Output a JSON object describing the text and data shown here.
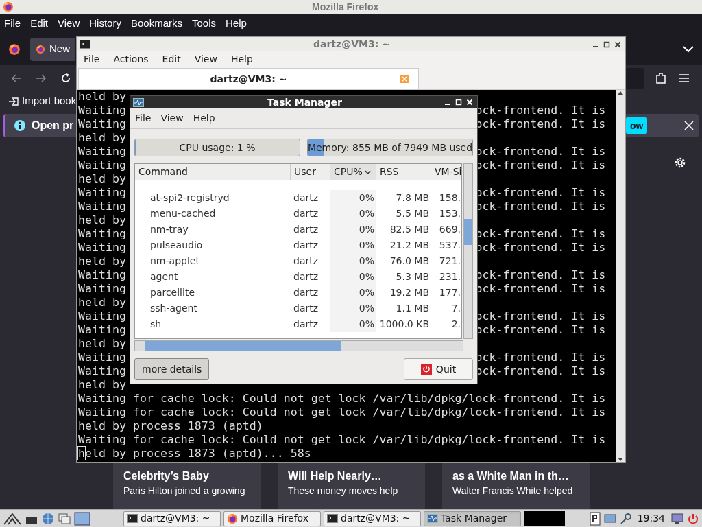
{
  "firefox": {
    "title": "Mozilla Firefox",
    "menu": [
      "File",
      "Edit",
      "View",
      "History",
      "Bookmarks",
      "Tools",
      "Help"
    ],
    "tab": {
      "label": "New"
    },
    "bookmark": "Import book",
    "notification": {
      "text": "Open pr",
      "button": "ow"
    },
    "cards": [
      {
        "title": "Celebrity’s Baby",
        "lines": [
          "Paris Hilton joined a growing"
        ]
      },
      {
        "title": "Will Help Nearly…",
        "lines": [
          "These money moves help"
        ]
      },
      {
        "title": "as a White Man in th…",
        "lines": [
          "Walter Francis White helped"
        ]
      }
    ]
  },
  "terminal": {
    "title": "dartz@VM3: ~",
    "menu": [
      "File",
      "Actions",
      "Edit",
      "View",
      "Help"
    ],
    "tab": {
      "label": "dartz@VM3: ~"
    },
    "lines": [
      {
        "text": "held by",
        "cursor": false
      },
      {
        "text": "Waiting",
        "tail": "ock-frontend. It is",
        "cursor": false
      },
      {
        "text": "Waiting",
        "tail": "ock-frontend. It is",
        "cursor": false
      },
      {
        "text": "held by",
        "cursor": false
      },
      {
        "text": "Waiting",
        "tail": "ock-frontend. It is",
        "cursor": false
      },
      {
        "text": "Waiting",
        "tail": "ock-frontend. It is",
        "cursor": false
      },
      {
        "text": "held by",
        "cursor": false
      },
      {
        "text": "Waiting",
        "tail": "ock-frontend. It is",
        "cursor": false
      },
      {
        "text": "Waiting",
        "tail": "ock-frontend. It is",
        "cursor": false
      },
      {
        "text": "held by",
        "cursor": false
      },
      {
        "text": "Waiting",
        "tail": "ock-frontend. It is",
        "cursor": false
      },
      {
        "text": "Waiting",
        "tail": "ock-frontend. It is",
        "cursor": false
      },
      {
        "text": "held by",
        "cursor": false
      },
      {
        "text": "Waiting",
        "tail": "ock-frontend. It is",
        "cursor": false
      },
      {
        "text": "Waiting",
        "tail": "ock-frontend. It is",
        "cursor": false
      },
      {
        "text": "held by",
        "cursor": false
      },
      {
        "text": "Waiting",
        "tail": "ock-frontend. It is",
        "cursor": false
      },
      {
        "text": "Waiting",
        "tail": "ock-frontend. It is",
        "cursor": false
      },
      {
        "text": "held by",
        "cursor": false
      },
      {
        "text": "Waiting",
        "tail": "ock-frontend. It is",
        "cursor": false
      },
      {
        "text": "Waiting",
        "tail": "ock-frontend. It is",
        "cursor": false
      },
      {
        "text": "held by",
        "cursor": false
      },
      {
        "text": "Waiting for cache lock: Could not get lock /var/lib/dpkg/lock-frontend. It is",
        "cursor": false
      },
      {
        "text": "Waiting for cache lock: Could not get lock /var/lib/dpkg/lock-frontend. It is",
        "cursor": false
      },
      {
        "text": "held by process 1873 (aptd)",
        "cursor": false
      },
      {
        "text": "Waiting for cache lock: Could not get lock /var/lib/dpkg/lock-frontend. It is",
        "cursor": false
      },
      {
        "text": "held by process 1873 (aptd)... 58s",
        "cursor": true
      }
    ]
  },
  "task_manager": {
    "title": "Task Manager",
    "menu": [
      "File",
      "View",
      "Help"
    ],
    "cpu": {
      "label": "CPU usage: 1 %",
      "level": 0.01
    },
    "memory": {
      "label": "Memory: 855 MB of 7949 MB used",
      "level": 0.1
    },
    "columns": [
      {
        "label": "Command",
        "sorted": false
      },
      {
        "label": "User",
        "sorted": false
      },
      {
        "label": "CPU%",
        "sorted": true
      },
      {
        "label": "RSS",
        "sorted": false
      },
      {
        "label": "VM-Si",
        "sorted": false
      }
    ],
    "rows": [
      [
        "at-spi2-registryd",
        "dartz",
        "0%",
        "7.8 MB",
        "158."
      ],
      [
        "menu-cached",
        "dartz",
        "0%",
        "5.5 MB",
        "153."
      ],
      [
        "nm-tray",
        "dartz",
        "0%",
        "82.5 MB",
        "669."
      ],
      [
        "pulseaudio",
        "dartz",
        "0%",
        "21.2 MB",
        "537."
      ],
      [
        "nm-applet",
        "dartz",
        "0%",
        "76.0 MB",
        "721."
      ],
      [
        "agent",
        "dartz",
        "0%",
        "5.3 MB",
        "231."
      ],
      [
        "parcellite",
        "dartz",
        "0%",
        "19.2 MB",
        "177."
      ],
      [
        "ssh-agent",
        "dartz",
        "0%",
        "1.1 MB",
        "7."
      ],
      [
        "sh",
        "dartz",
        "0%",
        "1000.0 KB",
        "2."
      ]
    ],
    "details_button": "more details",
    "quit_button": "Quit"
  },
  "taskbar": {
    "tasks": [
      {
        "label": "dartz@VM3: ~",
        "kind": "terminal",
        "selected": false
      },
      {
        "label": "Mozilla Firefox",
        "kind": "firefox",
        "selected": false
      },
      {
        "label": "dartz@VM3: ~",
        "kind": "terminal",
        "selected": false
      },
      {
        "label": "Task Manager",
        "kind": "monitor",
        "selected": true
      }
    ],
    "clock": "19:34"
  }
}
